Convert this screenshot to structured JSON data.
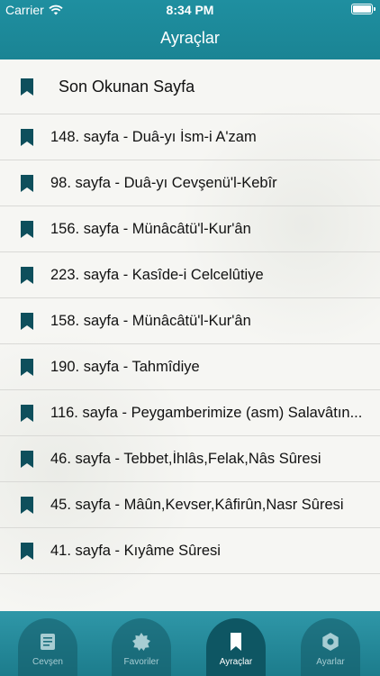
{
  "status": {
    "carrier": "Carrier",
    "time": "8:34 PM"
  },
  "header": {
    "title": "Ayraçlar"
  },
  "bookmarks": [
    {
      "label": "Son Okunan Sayfa"
    },
    {
      "label": "148. sayfa - Duâ-yı İsm-i A'zam"
    },
    {
      "label": "98. sayfa - Duâ-yı Cevşenü'l-Kebîr"
    },
    {
      "label": "156. sayfa - Münâcâtü'l-Kur'ân"
    },
    {
      "label": "223. sayfa - Kasîde-i Celcelûtiye"
    },
    {
      "label": "158. sayfa - Münâcâtü'l-Kur'ân"
    },
    {
      "label": "190. sayfa - Tahmîdiye"
    },
    {
      "label": "116. sayfa - Peygamberimize (asm) Salavâtın..."
    },
    {
      "label": "46. sayfa - Tebbet,İhlâs,Felak,Nâs Sûresi"
    },
    {
      "label": "45. sayfa - Mâûn,Kevser,Kâfirûn,Nasr Sûresi"
    },
    {
      "label": "41. sayfa - Kıyâme Sûresi"
    }
  ],
  "tabs": [
    {
      "label": "Cevşen",
      "icon": "book-icon",
      "active": false
    },
    {
      "label": "Favoriler",
      "icon": "star-badge-icon",
      "active": false
    },
    {
      "label": "Ayraçlar",
      "icon": "bookmark-icon",
      "active": true
    },
    {
      "label": "Ayarlar",
      "icon": "gear-icon",
      "active": false
    }
  ],
  "colors": {
    "header": "#1f8fa0",
    "bookmark_icon": "#0e4f5c",
    "active_tab": "#0e5663"
  }
}
